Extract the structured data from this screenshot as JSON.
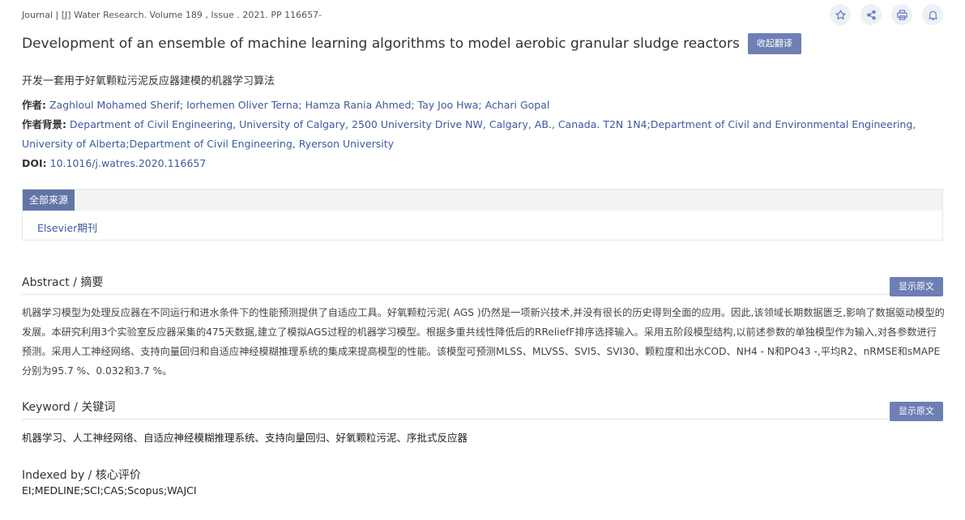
{
  "journal_line": "Journal | [J] Water Research. Volume 189 , Issue . 2021. PP 116657-",
  "actions": [
    {
      "icon": "star-icon",
      "label": "Favorite"
    },
    {
      "icon": "share-icon",
      "label": "Share"
    },
    {
      "icon": "print-icon",
      "label": "Print"
    },
    {
      "icon": "bell-icon",
      "label": "Subscribe"
    }
  ],
  "title": "Development of an ensemble of machine learning algorithms to model aerobic granular sludge reactors",
  "collapse_translation_label": "收起翻译",
  "cn_title": "开发一套用于好氧颗粒污泥反应器建模的机器学习算法",
  "authors": {
    "label": "作者:",
    "value": "Zaghloul Mohamed Sherif; Iorhemen Oliver Terna; Hamza Rania Ahmed; Tay Joo Hwa; Achari Gopal"
  },
  "affiliation": {
    "label": "作者背景:",
    "value": "Department of Civil Engineering, University of Calgary, 2500 University Drive NW, Calgary, AB., Canada. T2N 1N4;Department of Civil and Environmental Engineering, University of Alberta;Department of Civil Engineering, Ryerson University"
  },
  "doi": {
    "label": "DOI:",
    "value": "10.1016/j.watres.2020.116657"
  },
  "sources": {
    "tab_label": "全部来源",
    "items": [
      "Elsevier期刊"
    ]
  },
  "abstract": {
    "heading": "Abstract / 摘要",
    "show_original_label": "显示原文",
    "text": "机器学习模型为处理反应器在不同运行和进水条件下的性能预测提供了自适应工具。好氧颗粒污泥( AGS )仍然是一项新兴技术,并没有很长的历史得到全面的应用。因此,该领域长期数据匮乏,影响了数据驱动模型的发展。本研究利用3个实验室反应器采集的475天数据,建立了模拟AGS过程的机器学习模型。根据多重共线性降低后的RReliefF排序选择输入。采用五阶段模型结构,以前述参数的单独模型作为输入,对各参数进行预测。采用人工神经网络、支持向量回归和自适应神经模糊推理系统的集成来提高模型的性能。该模型可预测MLSS、MLVSS、SVI5、SVI30、颗粒度和出水COD、NH4 - N和PO43 -,平均R2、nRMSE和sMAPE分别为95.7 %、0.032和3.7 %。"
  },
  "keyword": {
    "heading": "Keyword / 关键词",
    "show_original_label": "显示原文",
    "text": "机器学习、人工神经网络、自适应神经模糊推理系统、支持向量回归、好氧颗粒污泥、序批式反应器"
  },
  "indexed": {
    "heading": "Indexed by / 核心评价",
    "text": "EI;MEDLINE;SCI;CAS;Scopus;WAJCI"
  },
  "colors": {
    "accent": "#6d7fb4",
    "link": "#3d5a9e",
    "tab": "#6275a6"
  }
}
